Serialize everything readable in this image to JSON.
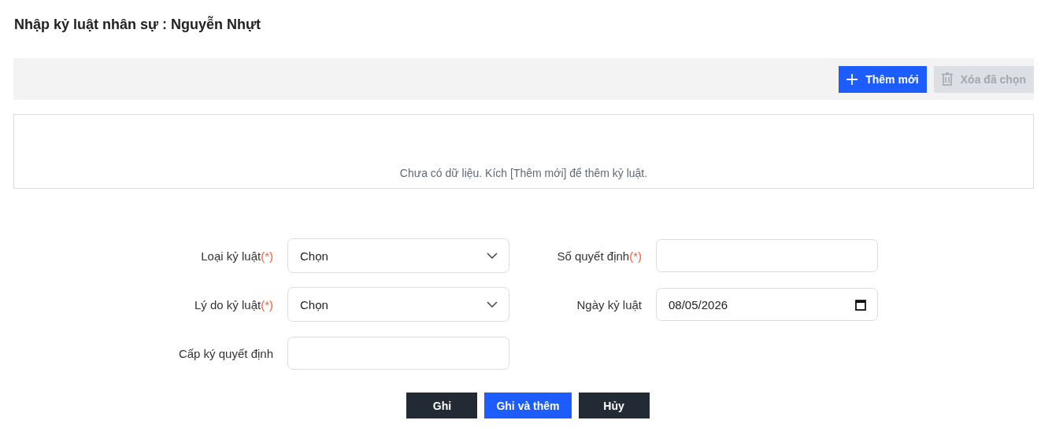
{
  "title": "Nhập kỷ luật nhân sự : Nguyễn Nhựt",
  "toolbar": [
    {
      "kind": "add",
      "label": "Thêm mới",
      "disabled": false
    },
    {
      "kind": "delete",
      "label": "Xóa đã chọn",
      "disabled": true
    }
  ],
  "table": {
    "empty_message": "Chưa có dữ liệu. Kích [Thêm mới] để thêm kỷ luật."
  },
  "form": {
    "left": [
      {
        "label": "Loại kỷ luật",
        "required": true,
        "kind": "select",
        "value": "Chọn"
      },
      {
        "label": "Lý do kỷ luật",
        "required": true,
        "kind": "select",
        "value": "Chọn"
      },
      {
        "label": "Cấp ký quyết định",
        "required": false,
        "kind": "text"
      }
    ],
    "right": [
      {
        "label": "Số quyết định",
        "required": true,
        "kind": "text"
      },
      {
        "label": "Ngày kỷ luật",
        "required": false,
        "kind": "date",
        "value": "08/05/2026"
      }
    ],
    "required_mark": "(*)"
  },
  "actions": [
    {
      "label": "Ghi",
      "kind": "dark"
    },
    {
      "label": "Ghi và thêm",
      "kind": "primary"
    },
    {
      "label": "Hủy",
      "kind": "dark"
    }
  ]
}
